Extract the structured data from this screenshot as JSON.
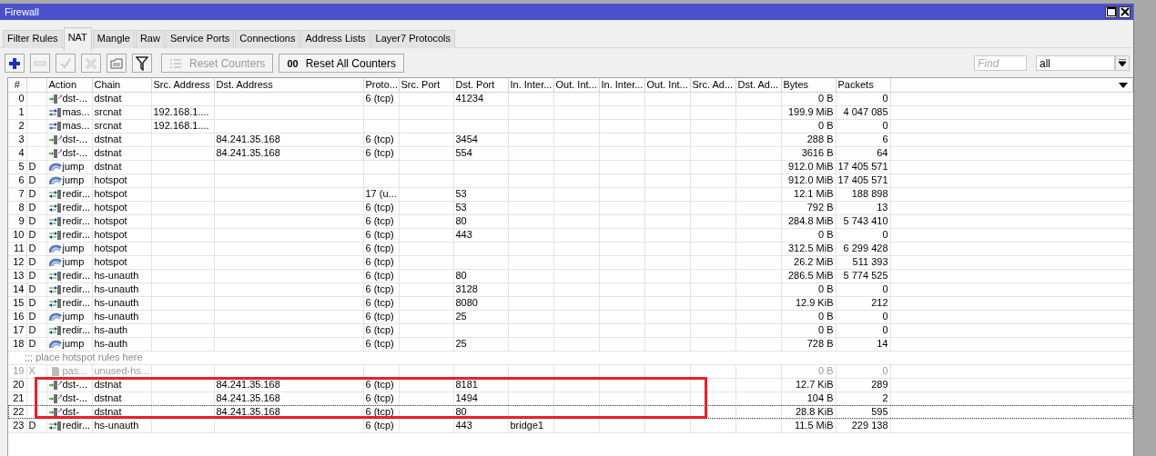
{
  "window": {
    "title": "Firewall"
  },
  "tabs": [
    {
      "label": "Filter Rules",
      "selected": false
    },
    {
      "label": "NAT",
      "selected": true
    },
    {
      "label": "Mangle",
      "selected": false
    },
    {
      "label": "Raw",
      "selected": false
    },
    {
      "label": "Service Ports",
      "selected": false
    },
    {
      "label": "Connections",
      "selected": false
    },
    {
      "label": "Address Lists",
      "selected": false
    },
    {
      "label": "Layer7 Protocols",
      "selected": false
    }
  ],
  "toolbar": {
    "buttons": [
      {
        "kind": "add",
        "disabled": false
      },
      {
        "kind": "remove",
        "disabled": true
      },
      {
        "kind": "enable",
        "disabled": true
      },
      {
        "kind": "disable",
        "disabled": true
      },
      {
        "kind": "comment",
        "disabled": false
      },
      {
        "kind": "filter",
        "disabled": false
      },
      {
        "kind": "reset",
        "label": "Reset Counters",
        "disabled": true
      },
      {
        "kind": "reset-all",
        "icon_text": "00",
        "label": "Reset All Counters",
        "disabled": false
      }
    ],
    "find": {
      "placeholder": "Find"
    },
    "filter_select": {
      "value": "all"
    }
  },
  "table": {
    "columns": [
      "#",
      "Action",
      "Chain",
      "Src. Address",
      "Dst. Address",
      "Proto...",
      "Src. Port",
      "Dst. Port",
      "In. Inter...",
      "Out. Int...",
      "In. Inter...",
      "Out. Int...",
      "Src. Ad...",
      "Dst. Ad...",
      "Bytes",
      "Packets"
    ],
    "rows": [
      {
        "kind": "rule",
        "number": "0",
        "action": {
          "kind": "dst-nat",
          "text": "dst-..."
        },
        "chain": "dstnat",
        "protocol": "6 (tcp)",
        "dst_port": "41234",
        "bytes": "0 B",
        "packets": "0",
        "disabled": false,
        "focused": false,
        "highlighted": false
      },
      {
        "kind": "rule",
        "number": "1",
        "action": {
          "kind": "masquerade",
          "text": "mas..."
        },
        "chain": "srcnat",
        "src_address": "192.168.1....",
        "bytes": "199.9 MiB",
        "packets": "4 047 085",
        "disabled": false,
        "focused": false,
        "highlighted": false
      },
      {
        "kind": "rule",
        "number": "2",
        "action": {
          "kind": "masquerade",
          "text": "mas..."
        },
        "chain": "srcnat",
        "src_address": "192.168.1....",
        "bytes": "0 B",
        "packets": "0",
        "disabled": false,
        "focused": false,
        "highlighted": false
      },
      {
        "kind": "rule",
        "number": "3",
        "action": {
          "kind": "dst-nat",
          "text": "dst-..."
        },
        "chain": "dstnat",
        "dst_address": "84.241.35.168",
        "protocol": "6 (tcp)",
        "dst_port": "3454",
        "bytes": "288 B",
        "packets": "6",
        "disabled": false,
        "focused": false,
        "highlighted": false
      },
      {
        "kind": "rule",
        "number": "4",
        "action": {
          "kind": "dst-nat",
          "text": "dst-..."
        },
        "chain": "dstnat",
        "dst_address": "84.241.35.168",
        "protocol": "6 (tcp)",
        "dst_port": "554",
        "bytes": "3616 B",
        "packets": "64",
        "disabled": false,
        "focused": false,
        "highlighted": false
      },
      {
        "kind": "rule",
        "number": "5",
        "flag": "D",
        "action": {
          "kind": "jump",
          "text": "jump"
        },
        "chain": "dstnat",
        "bytes": "912.0 MiB",
        "packets": "17 405 571",
        "disabled": false,
        "focused": false,
        "highlighted": false
      },
      {
        "kind": "rule",
        "number": "6",
        "flag": "D",
        "action": {
          "kind": "jump",
          "text": "jump"
        },
        "chain": "hotspot",
        "bytes": "912.0 MiB",
        "packets": "17 405 571",
        "disabled": false,
        "focused": false,
        "highlighted": false
      },
      {
        "kind": "rule",
        "number": "7",
        "flag": "D",
        "action": {
          "kind": "redirect",
          "text": "redir..."
        },
        "chain": "hotspot",
        "protocol": "17 (u...",
        "dst_port": "53",
        "bytes": "12.1 MiB",
        "packets": "188 898",
        "disabled": false,
        "focused": false,
        "highlighted": false
      },
      {
        "kind": "rule",
        "number": "8",
        "flag": "D",
        "action": {
          "kind": "redirect",
          "text": "redir..."
        },
        "chain": "hotspot",
        "protocol": "6 (tcp)",
        "dst_port": "53",
        "bytes": "792 B",
        "packets": "13",
        "disabled": false,
        "focused": false,
        "highlighted": false
      },
      {
        "kind": "rule",
        "number": "9",
        "flag": "D",
        "action": {
          "kind": "redirect",
          "text": "redir..."
        },
        "chain": "hotspot",
        "protocol": "6 (tcp)",
        "dst_port": "80",
        "bytes": "284.8 MiB",
        "packets": "5 743 410",
        "disabled": false,
        "focused": false,
        "highlighted": false
      },
      {
        "kind": "rule",
        "number": "10",
        "flag": "D",
        "action": {
          "kind": "redirect",
          "text": "redir..."
        },
        "chain": "hotspot",
        "protocol": "6 (tcp)",
        "dst_port": "443",
        "bytes": "0 B",
        "packets": "0",
        "disabled": false,
        "focused": false,
        "highlighted": false
      },
      {
        "kind": "rule",
        "number": "11",
        "flag": "D",
        "action": {
          "kind": "jump",
          "text": "jump"
        },
        "chain": "hotspot",
        "protocol": "6 (tcp)",
        "bytes": "312.5 MiB",
        "packets": "6 299 428",
        "disabled": false,
        "focused": false,
        "highlighted": false
      },
      {
        "kind": "rule",
        "number": "12",
        "flag": "D",
        "action": {
          "kind": "jump",
          "text": "jump"
        },
        "chain": "hotspot",
        "protocol": "6 (tcp)",
        "bytes": "26.2 MiB",
        "packets": "511 393",
        "disabled": false,
        "focused": false,
        "highlighted": false
      },
      {
        "kind": "rule",
        "number": "13",
        "flag": "D",
        "action": {
          "kind": "redirect",
          "text": "redir..."
        },
        "chain": "hs-unauth",
        "protocol": "6 (tcp)",
        "dst_port": "80",
        "bytes": "286.5 MiB",
        "packets": "5 774 525",
        "disabled": false,
        "focused": false,
        "highlighted": false
      },
      {
        "kind": "rule",
        "number": "14",
        "flag": "D",
        "action": {
          "kind": "redirect",
          "text": "redir..."
        },
        "chain": "hs-unauth",
        "protocol": "6 (tcp)",
        "dst_port": "3128",
        "bytes": "0 B",
        "packets": "0",
        "disabled": false,
        "focused": false,
        "highlighted": false
      },
      {
        "kind": "rule",
        "number": "15",
        "flag": "D",
        "action": {
          "kind": "redirect",
          "text": "redir..."
        },
        "chain": "hs-unauth",
        "protocol": "6 (tcp)",
        "dst_port": "8080",
        "bytes": "12.9 KiB",
        "packets": "212",
        "disabled": false,
        "focused": false,
        "highlighted": false
      },
      {
        "kind": "rule",
        "number": "16",
        "flag": "D",
        "action": {
          "kind": "jump",
          "text": "jump"
        },
        "chain": "hs-unauth",
        "protocol": "6 (tcp)",
        "dst_port": "25",
        "bytes": "0 B",
        "packets": "0",
        "disabled": false,
        "focused": false,
        "highlighted": false
      },
      {
        "kind": "rule",
        "number": "17",
        "flag": "D",
        "action": {
          "kind": "redirect",
          "text": "redir..."
        },
        "chain": "hs-auth",
        "protocol": "6 (tcp)",
        "bytes": "0 B",
        "packets": "0",
        "disabled": false,
        "focused": false,
        "highlighted": false
      },
      {
        "kind": "rule",
        "number": "18",
        "flag": "D",
        "action": {
          "kind": "jump",
          "text": "jump"
        },
        "chain": "hs-auth",
        "protocol": "6 (tcp)",
        "dst_port": "25",
        "bytes": "728 B",
        "packets": "14",
        "disabled": false,
        "focused": false,
        "highlighted": false
      },
      {
        "kind": "comment",
        "text": ";;; place hotspot rules here"
      },
      {
        "kind": "rule",
        "number": "19",
        "flag": "X",
        "action": {
          "kind": "passthrough",
          "text": "pas..."
        },
        "chain": "unused-hs...",
        "bytes": "0 B",
        "packets": "0",
        "disabled": true,
        "focused": false,
        "highlighted": false
      },
      {
        "kind": "rule",
        "number": "20",
        "action": {
          "kind": "dst-nat",
          "text": "dst-..."
        },
        "chain": "dstnat",
        "dst_address": "84.241.35.168",
        "protocol": "6 (tcp)",
        "dst_port": "8181",
        "bytes": "12.7 KiB",
        "packets": "289",
        "disabled": false,
        "focused": false,
        "highlighted": true
      },
      {
        "kind": "rule",
        "number": "21",
        "action": {
          "kind": "dst-nat",
          "text": "dst-..."
        },
        "chain": "dstnat",
        "dst_address": "84.241.35.168",
        "protocol": "6 (tcp)",
        "dst_port": "1494",
        "bytes": "104 B",
        "packets": "2",
        "disabled": false,
        "focused": false,
        "highlighted": true
      },
      {
        "kind": "rule",
        "number": "22",
        "action": {
          "kind": "dst-nat",
          "text": "dst-"
        },
        "chain": "dstnat",
        "dst_address": "84.241.35.168",
        "protocol": "6 (tcp)",
        "dst_port": "80",
        "bytes": "28.8 KiB",
        "packets": "595",
        "disabled": false,
        "focused": true,
        "highlighted": true
      },
      {
        "kind": "rule",
        "number": "23",
        "flag": "D",
        "action": {
          "kind": "redirect",
          "text": "redir..."
        },
        "chain": "hs-unauth",
        "protocol": "6 (tcp)",
        "dst_port": "443",
        "in_interface": "bridge1",
        "bytes": "11.5 MiB",
        "packets": "229 138",
        "disabled": false,
        "focused": false,
        "highlighted": false
      }
    ]
  }
}
